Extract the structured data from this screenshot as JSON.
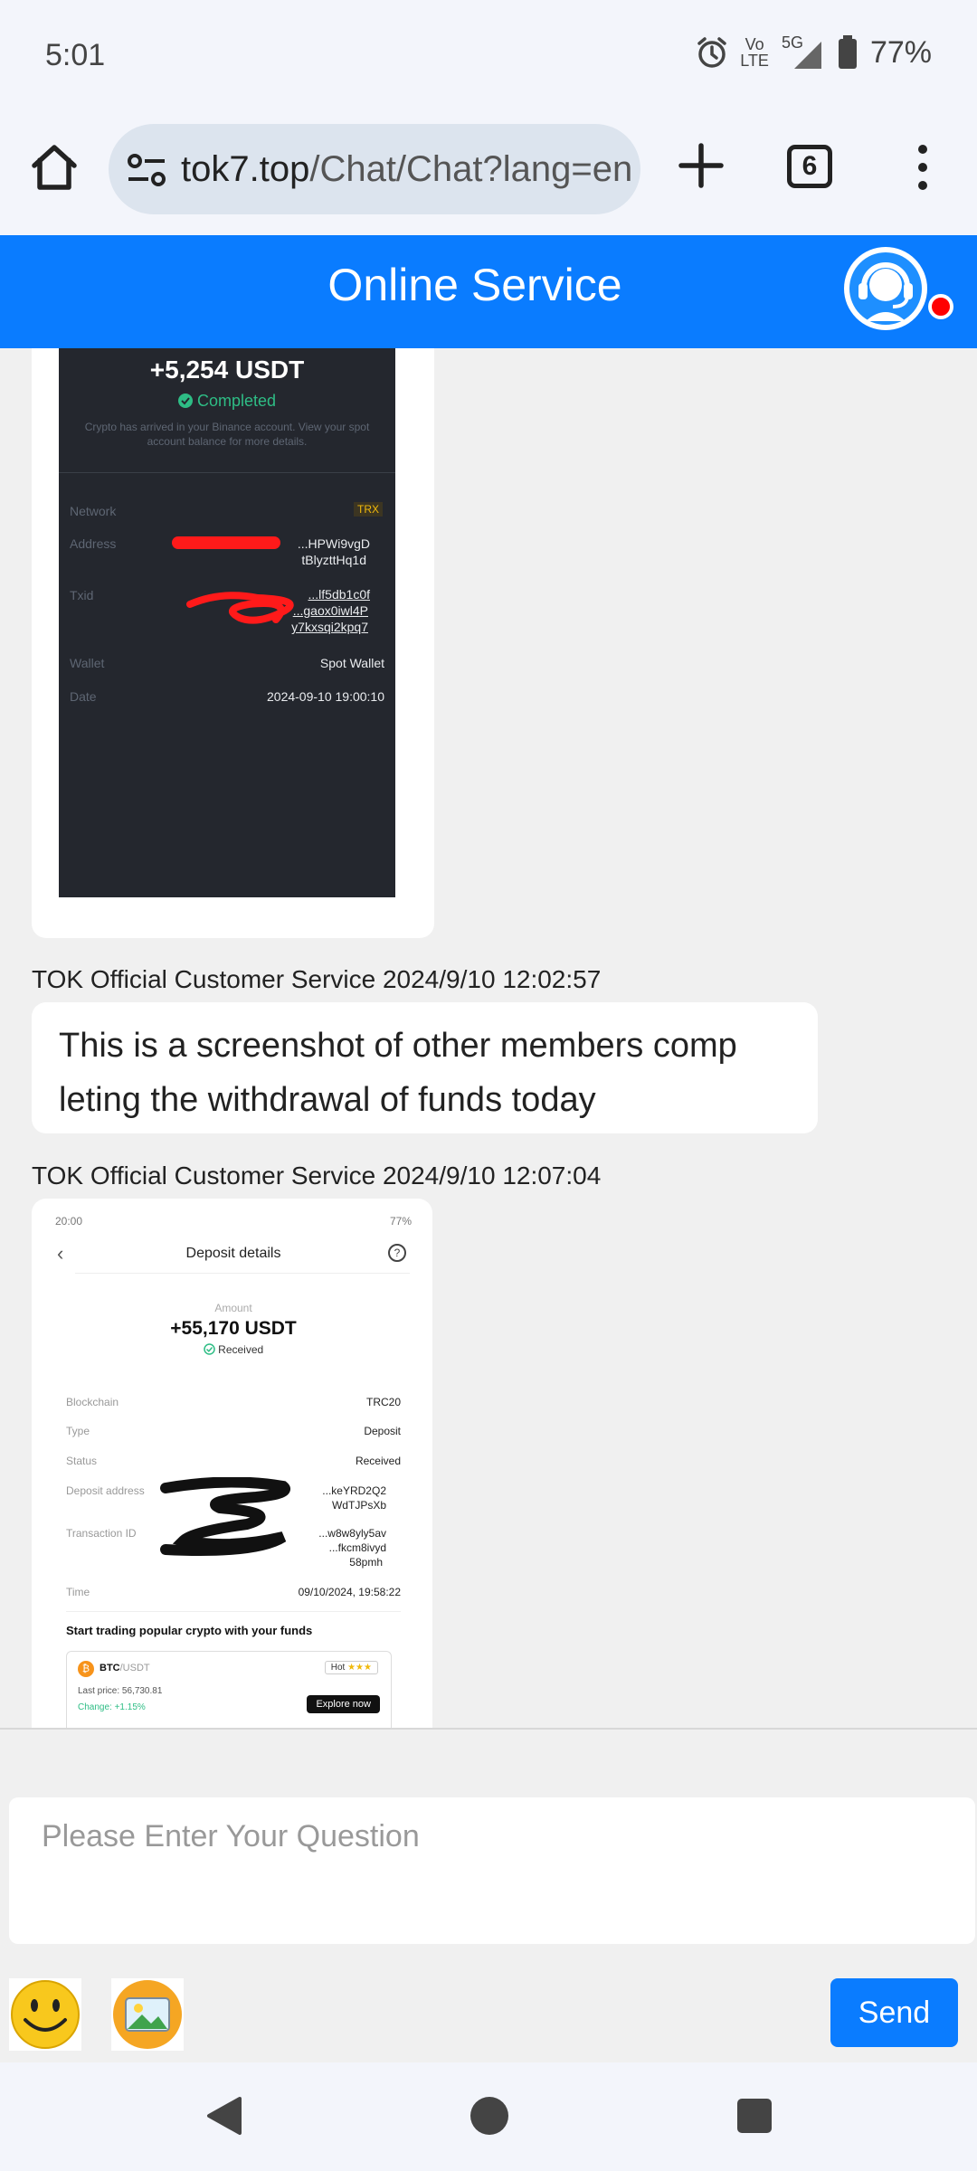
{
  "status_bar": {
    "time": "5:01",
    "network_top": "Vo",
    "network_bottom": "LTE",
    "network_gen": "5G",
    "battery": "77%"
  },
  "browser": {
    "url_domain": "tok7.top",
    "url_path": "/Chat/Chat?lang=en",
    "tab_count": "6"
  },
  "header": {
    "title": "Online Service",
    "accent_color": "#0a7cff",
    "online_dot_color": "#ff0000"
  },
  "messages": [
    {
      "type": "image",
      "receipt": {
        "amount": "+5,254 USDT",
        "status": "Completed",
        "note_line1": "Crypto has arrived in your Binance account. View your spot",
        "note_line2": "account balance for more details.",
        "rows": [
          {
            "label": "Network",
            "value": "TRX"
          },
          {
            "label": "Address",
            "value": "...HPWi9vgD",
            "value2": "tBlyzttHq1d"
          },
          {
            "label": "Txid",
            "value": "...lf5db1c0f",
            "value2": "...gaox0iwl4P",
            "value3": "y7kxsqi2kpq7"
          },
          {
            "label": "Wallet",
            "value": "Spot Wallet"
          },
          {
            "label": "Date",
            "value": "2024-09-10 19:00:10"
          }
        ]
      }
    },
    {
      "type": "text",
      "sender": "TOK Official Customer Service",
      "timestamp": "2024/9/10 12:02:57",
      "line1": "This is a screenshot of other members comp",
      "line2": "leting the withdrawal of funds today"
    },
    {
      "type": "image",
      "sender": "TOK Official Customer Service",
      "timestamp": "2024/9/10 12:07:04",
      "receipt": {
        "time": "20:00",
        "battery": "77%",
        "title": "Deposit details",
        "amount_label": "Amount",
        "amount": "+55,170 USDT",
        "status": "Received",
        "rows": [
          {
            "label": "Blockchain",
            "value": "TRC20"
          },
          {
            "label": "Type",
            "value": "Deposit"
          },
          {
            "label": "Status",
            "value": "Received"
          },
          {
            "label": "Deposit address",
            "value": "...keYRD2Q2",
            "value2": "WdTJPsXb"
          },
          {
            "label": "Transaction ID",
            "value": "...w8w8yly5av",
            "value2": "...fkcm8ivyd",
            "value3": "58pmh"
          },
          {
            "label": "Time",
            "value": "09/10/2024, 19:58:22"
          }
        ],
        "promo_title": "Start trading popular crypto with your funds",
        "pair_base": "BTC",
        "pair_quote": "/USDT",
        "hot": "Hot",
        "last_price": "Last price: 56,730.81",
        "change": "Change: +1.15%",
        "explore": "Explore now"
      }
    }
  ],
  "input": {
    "placeholder": "Please Enter Your Question",
    "send_label": "Send"
  }
}
